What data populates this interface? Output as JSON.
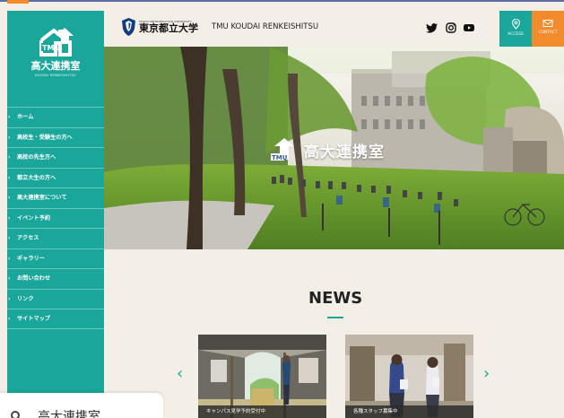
{
  "logo": {
    "main": "高大連携室",
    "sub": "KOUDAI RENKEISHITSU"
  },
  "header": {
    "university_small": "TOKYO METROPOLITAN UNIVERSITY",
    "university": "東京都立大学",
    "site_name": "TMU KOUDAI RENKEISHITSU",
    "access_label": "ACCESS",
    "contact_label": "CONTACT"
  },
  "nav": [
    {
      "label": "ホーム"
    },
    {
      "label": "高校生・受験生の方へ"
    },
    {
      "label": "高校の先生方へ"
    },
    {
      "label": "都立大生の方へ"
    },
    {
      "label": "高大連携室について"
    },
    {
      "label": "イベント予約"
    },
    {
      "label": "アクセス"
    },
    {
      "label": "ギャラリー"
    },
    {
      "label": "お問い合わせ"
    },
    {
      "label": "リンク"
    },
    {
      "label": "サイトマップ"
    }
  ],
  "hero": {
    "title": "高大連携室",
    "badge": "TMU"
  },
  "news": {
    "title": "NEWS",
    "items": [
      {
        "caption": "キャンパス見学予約受付中"
      },
      {
        "caption": "各種スタッフ募集中"
      }
    ]
  },
  "bottom_overlay": {
    "text": "高大連携室"
  },
  "colors": {
    "teal": "#1aa69a",
    "orange": "#f28b2c",
    "background": "#f3efe7"
  }
}
